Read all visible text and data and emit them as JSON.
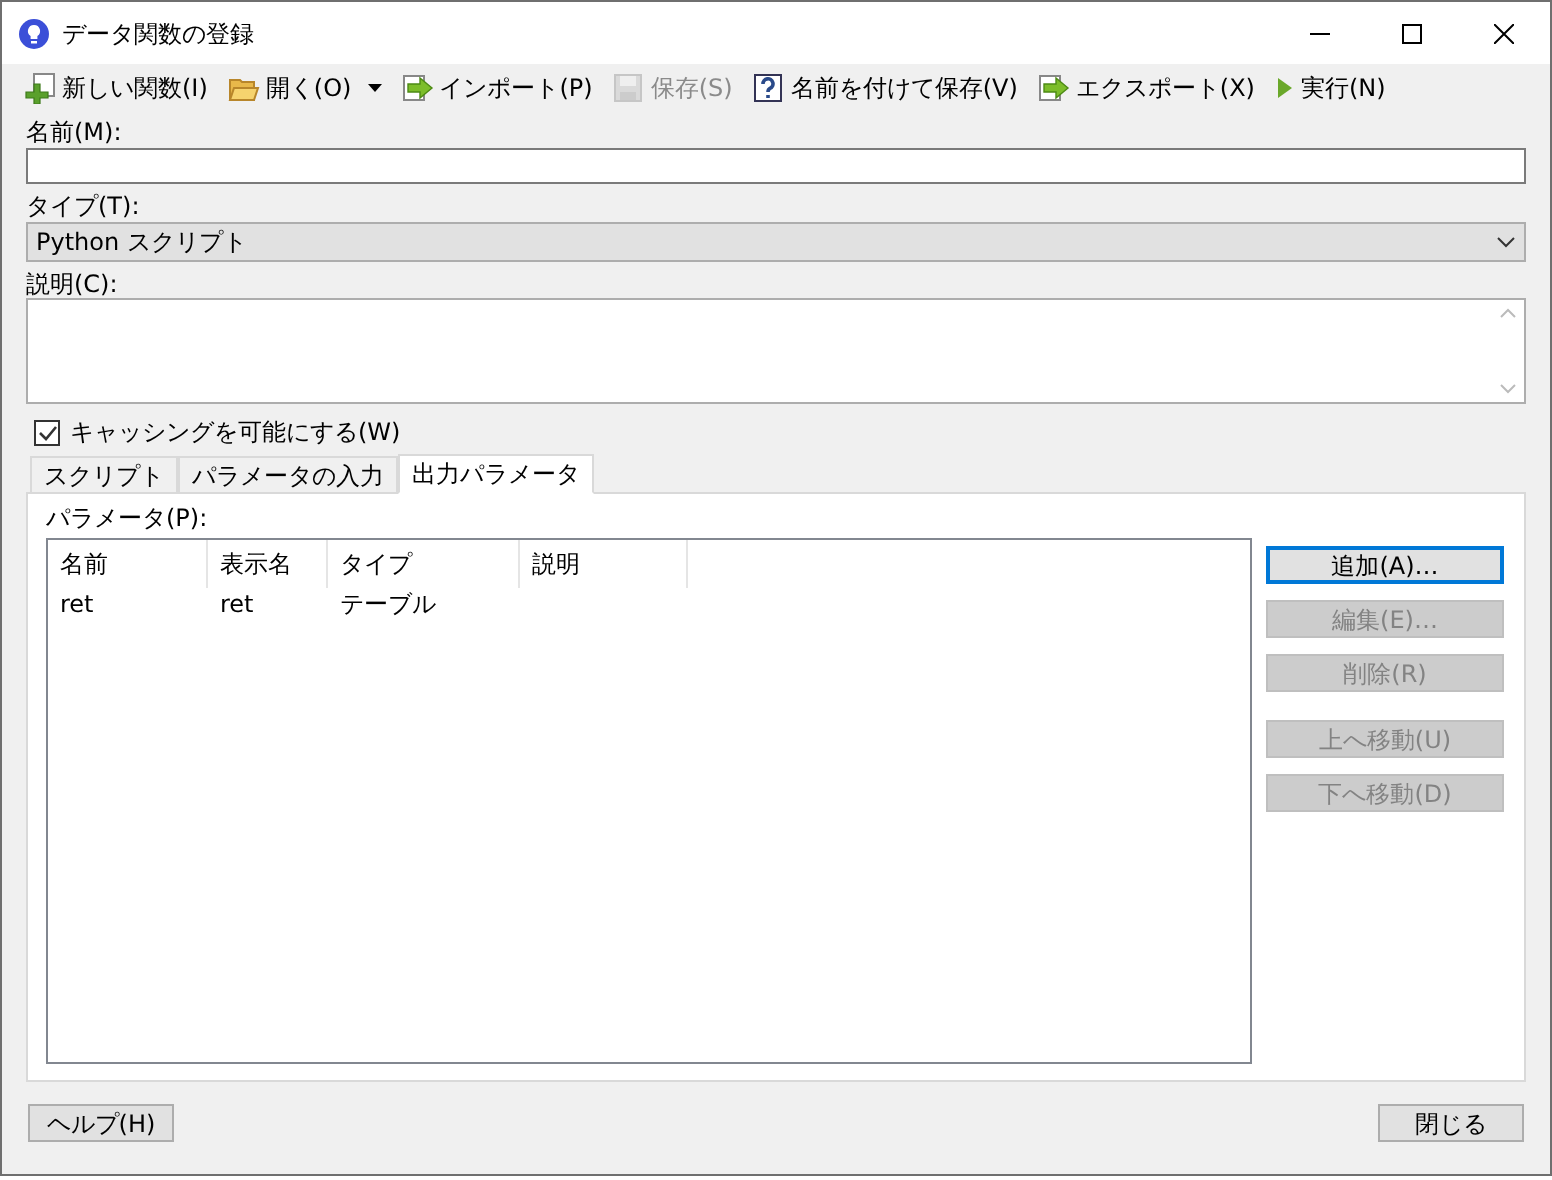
{
  "window": {
    "title": "データ関数の登録"
  },
  "toolbar": [
    {
      "kind": "new",
      "label": "新しい関数(I)",
      "disabled": false
    },
    {
      "kind": "open",
      "label": "開く(O)",
      "disabled": false,
      "dropdown": true
    },
    {
      "kind": "import",
      "label": "インポート(P)",
      "disabled": false
    },
    {
      "kind": "save",
      "label": "保存(S)",
      "disabled": true
    },
    {
      "kind": "saveas",
      "label": "名前を付けて保存(V)",
      "disabled": false
    },
    {
      "kind": "export",
      "label": "エクスポート(X)",
      "disabled": false
    },
    {
      "kind": "run",
      "label": "実行(N)",
      "disabled": false
    }
  ],
  "name_field": {
    "label": "名前(M):"
  },
  "type_field": {
    "label": "タイプ(T):",
    "value": "Python スクリプト"
  },
  "description_field": {
    "label": "説明(C):"
  },
  "caching": {
    "label": "キャッシングを可能にする(W)",
    "checked": true
  },
  "tabs": [
    {
      "label": "スクリプト",
      "selected": false
    },
    {
      "label": "パラメータの入力",
      "selected": false
    },
    {
      "label": "出力パラメータ",
      "selected": true
    }
  ],
  "parameters": {
    "label": "パラメータ(P):",
    "columns": [
      "名前",
      "表示名",
      "タイプ",
      "説明"
    ],
    "rows": [
      [
        "ret",
        "ret",
        "テーブル",
        ""
      ]
    ]
  },
  "side_buttons": [
    {
      "label": "追加(A)…",
      "disabled": false,
      "focused": true
    },
    {
      "label": "編集(E)…",
      "disabled": true,
      "focused": false
    },
    {
      "label": "削除(R)",
      "disabled": true,
      "focused": false
    }
  ],
  "move_buttons": [
    {
      "label": "上へ移動(U)",
      "disabled": true,
      "focused": false
    },
    {
      "label": "下へ移動(D)",
      "disabled": true,
      "focused": false
    }
  ],
  "footer": {
    "help": "ヘルプ(H)",
    "close": "閉じる"
  }
}
